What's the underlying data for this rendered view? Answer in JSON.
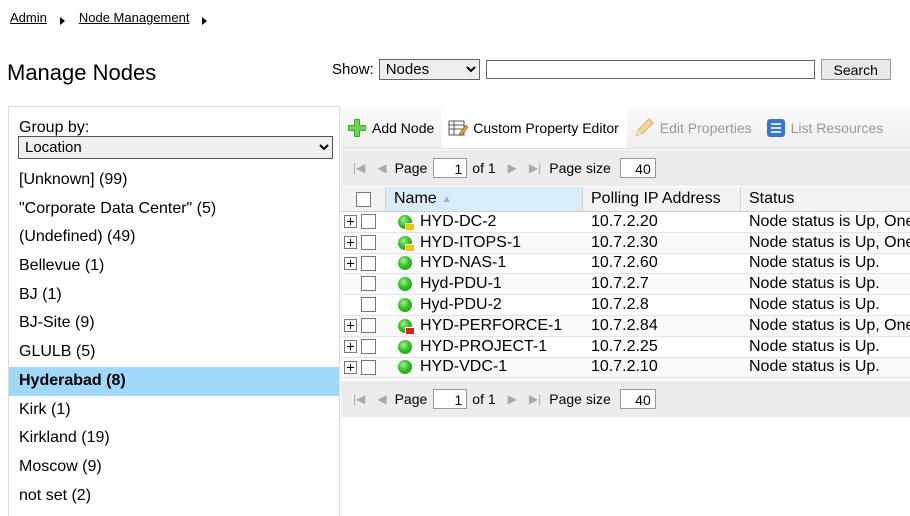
{
  "breadcrumb": [
    "Admin",
    "Node Management"
  ],
  "page_title": "Manage Nodes",
  "show": {
    "label": "Show:",
    "selected": "Nodes",
    "search_value": "",
    "search_button": "Search"
  },
  "group_by": {
    "label": "Group by:",
    "selected": "Location",
    "groups": [
      {
        "label": "[Unknown] (99)"
      },
      {
        "label": "\"Corporate Data Center\" (5)"
      },
      {
        "label": "(Undefined) (49)"
      },
      {
        "label": "Bellevue (1)"
      },
      {
        "label": "BJ (1)"
      },
      {
        "label": "BJ-Site (9)"
      },
      {
        "label": "GLULB (5)"
      },
      {
        "label": "Hyderabad (8)",
        "selected": true
      },
      {
        "label": "Kirk (1)"
      },
      {
        "label": "Kirkland (19)"
      },
      {
        "label": "Moscow (9)"
      },
      {
        "label": "not set (2)"
      }
    ]
  },
  "toolbar": {
    "add_node": "Add Node",
    "custom_property_editor": "Custom Property Editor",
    "edit_properties": "Edit Properties",
    "list_resources": "List Resources"
  },
  "pager": {
    "page_label": "Page",
    "page_value": "1",
    "of_label": "of 1",
    "page_size_label": "Page size",
    "page_size_value": "40"
  },
  "table": {
    "columns": [
      "Name",
      "Polling IP Address",
      "Status"
    ],
    "rows": [
      {
        "name": "HYD-DC-2",
        "ip": "10.7.2.20",
        "status": "Node status is Up, One or more interfaces are in a warning state.",
        "expandable": true,
        "badge": "yellow"
      },
      {
        "name": "HYD-ITOPS-1",
        "ip": "10.7.2.30",
        "status": "Node status is Up, One or more interfaces are in a warning state.",
        "expandable": true,
        "badge": "yellow"
      },
      {
        "name": "HYD-NAS-1",
        "ip": "10.7.2.60",
        "status": "Node status is Up.",
        "expandable": true,
        "badge": ""
      },
      {
        "name": "Hyd-PDU-1",
        "ip": "10.7.2.7",
        "status": "Node status is Up.",
        "expandable": false,
        "badge": ""
      },
      {
        "name": "Hyd-PDU-2",
        "ip": "10.7.2.8",
        "status": "Node status is Up.",
        "expandable": false,
        "badge": ""
      },
      {
        "name": "HYD-PERFORCE-1",
        "ip": "10.7.2.84",
        "status": "Node status is Up, One or more interfaces are in a critical state.",
        "expandable": true,
        "badge": "red"
      },
      {
        "name": "HYD-PROJECT-1",
        "ip": "10.7.2.25",
        "status": "Node status is Up.",
        "expandable": true,
        "badge": ""
      },
      {
        "name": "HYD-VDC-1",
        "ip": "10.7.2.10",
        "status": "Node status is Up.",
        "expandable": true,
        "badge": ""
      }
    ]
  },
  "colors": {
    "selected_group": "#9fd8f8",
    "status_up": "#34c021",
    "warning": "#f2c300",
    "critical": "#e02020"
  }
}
